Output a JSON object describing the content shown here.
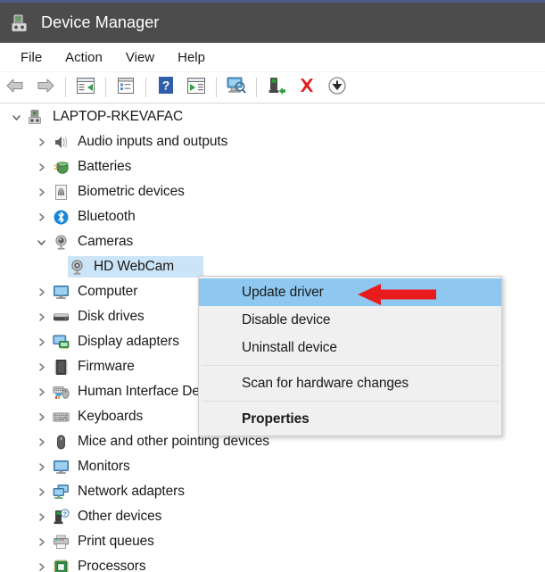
{
  "window": {
    "title": "Device Manager",
    "title_icon": "device-manager-icon",
    "titlebar_color": "#4c4c4c",
    "accent_color": "#4a5b86"
  },
  "menubar": {
    "items": [
      {
        "label": "File",
        "name": "menu-file"
      },
      {
        "label": "Action",
        "name": "menu-action"
      },
      {
        "label": "View",
        "name": "menu-view"
      },
      {
        "label": "Help",
        "name": "menu-help"
      }
    ]
  },
  "toolbar": {
    "buttons": [
      {
        "icon": "back-arrow-icon",
        "name": "toolbar-back"
      },
      {
        "icon": "forward-arrow-icon",
        "name": "toolbar-forward"
      },
      {
        "sep": true
      },
      {
        "icon": "show-hide-console-tree-icon",
        "name": "toolbar-show-tree"
      },
      {
        "sep": true
      },
      {
        "icon": "properties-icon",
        "name": "toolbar-properties"
      },
      {
        "sep": true
      },
      {
        "icon": "help-icon",
        "name": "toolbar-help"
      },
      {
        "icon": "update-driver-icon",
        "name": "toolbar-update-driver"
      },
      {
        "sep": true
      },
      {
        "icon": "scan-hardware-changes-icon",
        "name": "toolbar-scan"
      },
      {
        "sep": true
      },
      {
        "icon": "enable-device-icon",
        "name": "toolbar-enable-device"
      },
      {
        "icon": "uninstall-device-icon",
        "name": "toolbar-uninstall"
      },
      {
        "icon": "disable-device-icon",
        "name": "toolbar-disable"
      }
    ]
  },
  "tree": {
    "nodes": [
      {
        "label": "LAPTOP-RKEVAFAC",
        "icon": "computer-root-icon",
        "indent": 0,
        "state": "expanded",
        "selected": false
      },
      {
        "label": "Audio inputs and outputs",
        "icon": "speaker-icon",
        "indent": 1,
        "state": "collapsed",
        "selected": false
      },
      {
        "label": "Batteries",
        "icon": "battery-icon",
        "indent": 1,
        "state": "collapsed",
        "selected": false
      },
      {
        "label": "Biometric devices",
        "icon": "fingerprint-icon",
        "indent": 1,
        "state": "collapsed",
        "selected": false
      },
      {
        "label": "Bluetooth",
        "icon": "bluetooth-icon",
        "indent": 1,
        "state": "collapsed",
        "selected": false
      },
      {
        "label": "Cameras",
        "icon": "camera-icon",
        "indent": 1,
        "state": "expanded",
        "selected": false
      },
      {
        "label": "HD WebCam",
        "icon": "camera-device-icon",
        "indent": 2,
        "state": "leaf",
        "selected": true
      },
      {
        "label": "Computer",
        "icon": "monitor-icon",
        "indent": 1,
        "state": "collapsed",
        "selected": false
      },
      {
        "label": "Disk drives",
        "icon": "disk-drive-icon",
        "indent": 1,
        "state": "collapsed",
        "selected": false
      },
      {
        "label": "Display adapters",
        "icon": "display-adapter-icon",
        "indent": 1,
        "state": "collapsed",
        "selected": false
      },
      {
        "label": "Firmware",
        "icon": "firmware-chip-icon",
        "indent": 1,
        "state": "collapsed",
        "selected": false
      },
      {
        "label": "Human Interface Devices",
        "icon": "hid-icon",
        "indent": 1,
        "state": "collapsed",
        "selected": false
      },
      {
        "label": "Keyboards",
        "icon": "keyboard-icon",
        "indent": 1,
        "state": "collapsed",
        "selected": false
      },
      {
        "label": "Mice and other pointing devices",
        "icon": "mouse-icon",
        "indent": 1,
        "state": "collapsed",
        "selected": false
      },
      {
        "label": "Monitors",
        "icon": "monitor-icon",
        "indent": 1,
        "state": "collapsed",
        "selected": false
      },
      {
        "label": "Network adapters",
        "icon": "network-adapter-icon",
        "indent": 1,
        "state": "collapsed",
        "selected": false
      },
      {
        "label": "Other devices",
        "icon": "other-device-icon",
        "indent": 1,
        "state": "collapsed",
        "selected": false
      },
      {
        "label": "Print queues",
        "icon": "printer-icon",
        "indent": 1,
        "state": "collapsed",
        "selected": false
      },
      {
        "label": "Processors",
        "icon": "processor-icon",
        "indent": 1,
        "state": "collapsed",
        "selected": false
      }
    ],
    "selection_color": "#cce4f7"
  },
  "context_menu": {
    "highlight_color": "#8ec8f0",
    "items": [
      {
        "label": "Update driver",
        "name": "ctx-update-driver",
        "highlighted": true,
        "bold": false
      },
      {
        "label": "Disable device",
        "name": "ctx-disable-device",
        "highlighted": false,
        "bold": false
      },
      {
        "label": "Uninstall device",
        "name": "ctx-uninstall-device",
        "highlighted": false,
        "bold": false
      },
      {
        "separator": true
      },
      {
        "label": "Scan for hardware changes",
        "name": "ctx-scan-hardware",
        "highlighted": false,
        "bold": false
      },
      {
        "separator": true
      },
      {
        "label": "Properties",
        "name": "ctx-properties",
        "highlighted": false,
        "bold": true
      }
    ]
  },
  "annotation": {
    "arrow": {
      "icon": "red-left-arrow-annotation",
      "color": "#e81c1c",
      "direction": "left"
    }
  }
}
